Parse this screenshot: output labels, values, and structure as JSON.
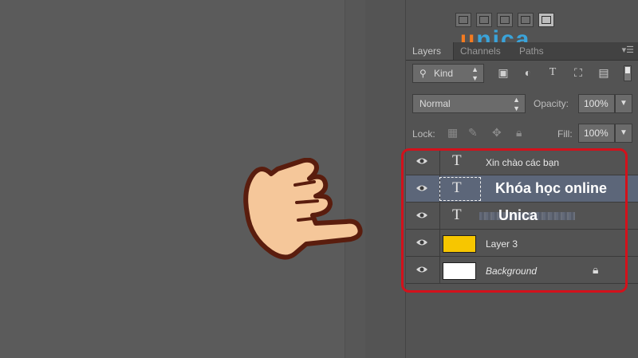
{
  "logo": {
    "u": "u",
    "rest": "nica"
  },
  "tabs": [
    {
      "label": "Layers",
      "active": true
    },
    {
      "label": "Channels",
      "active": false
    },
    {
      "label": "Paths",
      "active": false
    }
  ],
  "filter": {
    "kind_label": "Kind",
    "icons": [
      "image-filter-icon",
      "adjustment-filter-icon",
      "type-filter-icon",
      "shape-filter-icon",
      "smart-object-filter-icon"
    ]
  },
  "blend": {
    "mode": "Normal",
    "opacity_label": "Opacity:",
    "opacity_value": "100%"
  },
  "lock": {
    "label": "Lock:",
    "fill_label": "Fill:",
    "fill_value": "100%"
  },
  "layers": [
    {
      "name": "Xin chào các bạn",
      "type": "text"
    },
    {
      "name": "Khóa học online",
      "type": "text",
      "selected": true
    },
    {
      "name": "Unica",
      "type": "text"
    },
    {
      "name": "Layer 3",
      "type": "fill",
      "color": "#f7c600"
    },
    {
      "name": "Background",
      "type": "fill",
      "color": "#ffffff",
      "locked": true
    }
  ],
  "colors": {
    "highlight": "#d3111b",
    "selected_row": "#5c6679",
    "accent_orange": "#f47b20",
    "accent_blue": "#3aa3d9"
  }
}
